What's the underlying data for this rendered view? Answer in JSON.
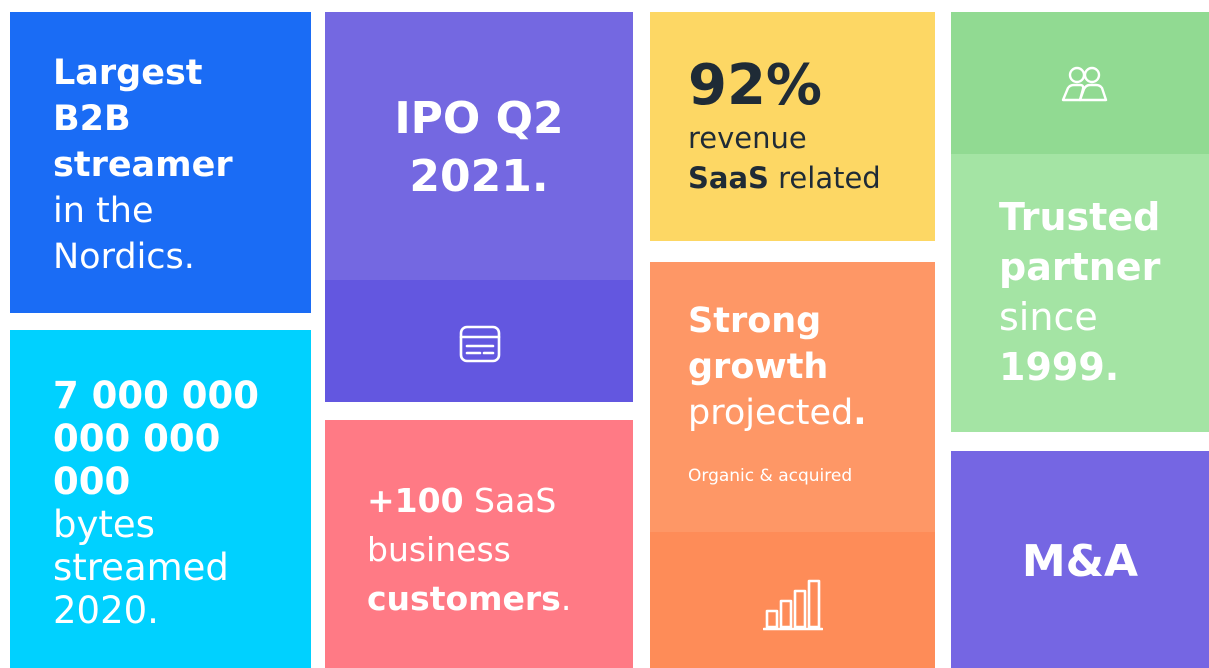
{
  "colors": {
    "blue": "#1a6cf5",
    "cyan": "#00d1ff",
    "purple": "#7468e1",
    "purple_dark": "#6357e0",
    "pink": "#ff7a85",
    "yellow": "#fdd764",
    "orange": "#fe9766",
    "orange_dark": "#fe8c58",
    "green_dark": "#91da92",
    "green": "#a4e4a4",
    "violet": "#7566e3",
    "ink": "#1f2b36"
  },
  "tiles": {
    "nordics": {
      "line1": "Largest",
      "line2": "B2B",
      "line3": "streamer",
      "line4": "in the",
      "line5": "Nordics."
    },
    "bytes": {
      "line1": "7 000 000",
      "line2": "000 000",
      "line3": "000",
      "line4": "bytes",
      "line5": "streamed",
      "line6": "2020."
    },
    "ipo": {
      "line1": "IPO Q2",
      "line2": "2021.",
      "icon": "calendar-icon"
    },
    "customers": {
      "line1_bold": "+100",
      "line1_rest": " SaaS",
      "line2": "business",
      "line3": "customers",
      "line3_dot": "."
    },
    "revenue": {
      "percent": "92%",
      "line2": "revenue",
      "line3_bold": "SaaS",
      "line3_rest": " related"
    },
    "growth": {
      "line1": "Strong",
      "line2": "growth",
      "line3": "projected",
      "line3_dot": ".",
      "sub": "Organic & acquired",
      "icon": "bar-chart-icon"
    },
    "partner": {
      "icon": "users-icon",
      "line1": "Trusted",
      "line2": "partner",
      "line3": "since",
      "line4": "1999."
    },
    "ma": {
      "label": "M&A"
    }
  }
}
